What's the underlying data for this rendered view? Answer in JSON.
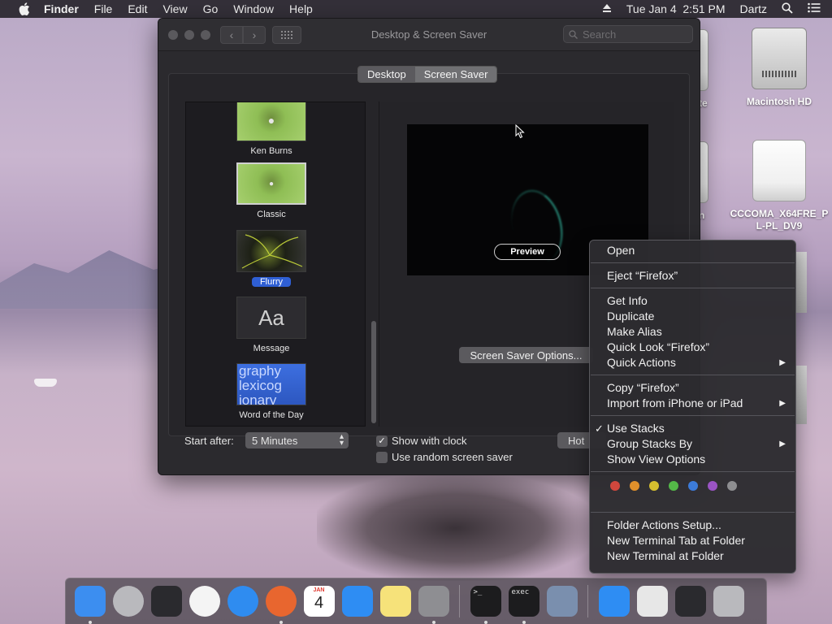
{
  "menubar": {
    "app_name": "Finder",
    "items": [
      "File",
      "Edit",
      "View",
      "Go",
      "Window",
      "Help"
    ],
    "datetime": "Tue Jan 4  2:51 PM",
    "user": "Dartz"
  },
  "desktop": {
    "icons": [
      {
        "label": "ate"
      },
      {
        "label": "Macintosh HD"
      },
      {
        "label": "in"
      },
      {
        "label": "CCCOMA_X64FRE_PL-PL_DV9"
      }
    ]
  },
  "window": {
    "title": "Desktop & Screen Saver",
    "search_placeholder": "Search",
    "tabs": [
      {
        "label": "Desktop",
        "active": false
      },
      {
        "label": "Screen Saver",
        "active": true
      }
    ],
    "savers": [
      {
        "label": "Ken Burns"
      },
      {
        "label": "Classic"
      },
      {
        "label": "Flurry",
        "selected": true
      },
      {
        "label": "Message",
        "thumb_text": "Aa"
      },
      {
        "label": "Word of the Day",
        "thumb_text": "graphy lexicog ionary"
      }
    ],
    "preview_label": "Preview",
    "options_label": "Screen Saver Options...",
    "start_after_label": "Start after:",
    "start_after_value": "5 Minutes",
    "show_clock_label": "Show with clock",
    "show_clock_checked": true,
    "random_label": "Use random screen saver",
    "random_checked": false,
    "hot_corners_label": "Hot"
  },
  "context_menu": {
    "open": "Open",
    "eject": "Eject “Firefox”",
    "get_info": "Get Info",
    "duplicate": "Duplicate",
    "make_alias": "Make Alias",
    "quick_look": "Quick Look “Firefox”",
    "quick_actions": "Quick Actions",
    "copy": "Copy “Firefox”",
    "import": "Import from iPhone or iPad",
    "use_stacks": "Use Stacks",
    "group_stacks": "Group Stacks By",
    "view_options": "Show View Options",
    "tag_colors": [
      "#d0473d",
      "#e0902b",
      "#d6bf2f",
      "#54b848",
      "#3c7bd9",
      "#9a54c4",
      "#8e8e91"
    ],
    "folder_actions": "Folder Actions Setup...",
    "terminal_tab": "New Terminal Tab at Folder",
    "terminal": "New Terminal at Folder"
  },
  "dock": {
    "apps": [
      {
        "name": "finder-icon",
        "color": "#3c8ef0",
        "running": true
      },
      {
        "name": "launchpad-icon",
        "color": "#b9b9bd",
        "running": false
      },
      {
        "name": "photo-browser-icon",
        "color": "#2a2a2e",
        "running": false
      },
      {
        "name": "chrome-icon",
        "color": "#f4f4f4",
        "running": false
      },
      {
        "name": "safari-icon",
        "color": "#2f8cf0",
        "running": false
      },
      {
        "name": "firefox-icon",
        "color": "#e8662f",
        "running": true
      },
      {
        "name": "calendar-icon",
        "color": "#ffffff",
        "running": false,
        "month": "JAN",
        "day": "4"
      },
      {
        "name": "app-store-icon",
        "color": "#2e8df3",
        "running": false
      },
      {
        "name": "notes-icon",
        "color": "#f6e27a",
        "running": false
      },
      {
        "name": "system-preferences-icon",
        "color": "#8e8e92",
        "running": true
      },
      {
        "name": "terminal-icon",
        "color": "#1c1c1e",
        "running": true,
        "text": ">_"
      },
      {
        "name": "exec-icon",
        "color": "#1c1c1e",
        "running": true,
        "text": "exec"
      },
      {
        "name": "mail-stamp-icon",
        "color": "#7a8fae",
        "running": false
      },
      {
        "name": "app-store-folder-icon",
        "color": "#2e8df3",
        "running": false
      },
      {
        "name": "document-stack-icon",
        "color": "#e7e7e7",
        "running": false
      },
      {
        "name": "firefox-stack-icon",
        "color": "#2a2a2e",
        "running": false
      },
      {
        "name": "trash-icon",
        "color": "#b9b9bd",
        "running": false
      }
    ]
  }
}
